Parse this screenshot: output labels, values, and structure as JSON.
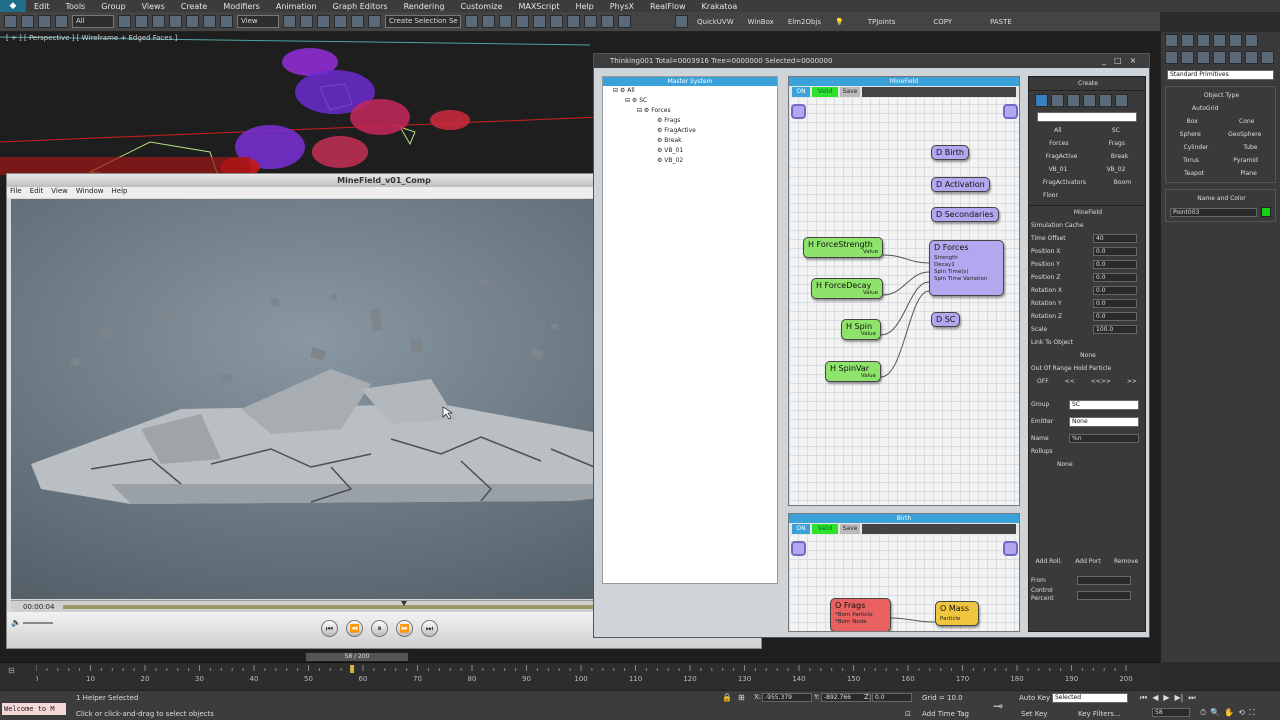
{
  "menu": [
    "Edit",
    "Tools",
    "Group",
    "Views",
    "Create",
    "Modifiers",
    "Animation",
    "Graph Editors",
    "Rendering",
    "Customize",
    "MAXScript",
    "Help",
    "PhysX",
    "RealFlow",
    "Krakatoa"
  ],
  "toolbar": {
    "filter": "All",
    "ref_coord": "View",
    "selection_set": "Create Selection Se",
    "quickuvw": "QuickUVW",
    "winbox": "WinBox",
    "elm2objs": "Elm2Objs",
    "tpjoints": "TPJoints",
    "copy": "COPY",
    "paste": "PASTE"
  },
  "viewport": {
    "label": "[ + ] [ Perspective ] [ Wireframe + Edged Faces ]"
  },
  "player": {
    "title": "MineField_v01_Comp",
    "menu": [
      "File",
      "Edit",
      "View",
      "Window",
      "Help"
    ],
    "time": "00:00:04",
    "buttons": [
      "⏮",
      "⏪",
      "⏸",
      "⏩",
      "⏭"
    ]
  },
  "thinking": {
    "title": "Thinking001  Total=0003916  Tree=0000000  Selected=0000000",
    "master_header": "Master System",
    "tree": [
      {
        "label": "All",
        "depth": 0
      },
      {
        "label": "SC",
        "depth": 1
      },
      {
        "label": "Forces",
        "depth": 2
      },
      {
        "label": "Frags",
        "depth": 3
      },
      {
        "label": "FragActive",
        "depth": 3
      },
      {
        "label": "Break",
        "depth": 3
      },
      {
        "label": "VB_01",
        "depth": 3
      },
      {
        "label": "VB_02",
        "depth": 3
      }
    ],
    "minefield_header": "MineField",
    "birth_header": "Birth",
    "bar": {
      "on": "ON",
      "valid": "Valid",
      "save": "Save"
    },
    "nodes": {
      "d_birth": "D Birth",
      "d_activation": "D Activation",
      "d_secondaries": "D Secondaries",
      "d_forces": "D Forces",
      "d_forces_list": [
        "Strength",
        "Decay1",
        "Spin Time(s)",
        "Spin Time Variation"
      ],
      "d_sc": "D SC",
      "h_forcestrength": "H ForceStrength",
      "h_forcedecay": "H ForceDecay",
      "h_spin": "H Spin",
      "h_spinvar": "H SpinVar",
      "value": "Value",
      "o_frags": "O Frags",
      "o_frags_list": [
        "*Born Particle",
        "*Born Node"
      ],
      "o_mass": "O Mass",
      "o_mass_sub": "Particle"
    },
    "create": {
      "header": "Create",
      "groups": [
        [
          "All",
          "SC"
        ],
        [
          "Forces",
          "Frags"
        ],
        [
          "FragActive",
          "Break"
        ],
        [
          "VB_01",
          "VB_02"
        ],
        [
          "FragActivators",
          "Boom"
        ],
        [
          "Floor",
          ""
        ]
      ],
      "minefield_header": "MineField",
      "sim_cache": "Simulation Cache",
      "fields": [
        {
          "label": "Time Offset",
          "value": "40"
        },
        {
          "label": "Position X",
          "value": "0.0"
        },
        {
          "label": "Position Y",
          "value": "0.0"
        },
        {
          "label": "Position Z",
          "value": "0.0"
        },
        {
          "label": "Rotation X",
          "value": "0.0"
        },
        {
          "label": "Rotation Y",
          "value": "0.0"
        },
        {
          "label": "Rotation Z",
          "value": "0.0"
        },
        {
          "label": "Scale",
          "value": "100.0"
        }
      ],
      "link_to_object": "Link To Object",
      "none": "None",
      "out_of_range": "Out Of Range Hold Particle",
      "nav": [
        "OFF",
        "<<",
        "<<>>",
        ">>"
      ],
      "group_label": "Group",
      "group_value": "SC",
      "emitter_label": "Emitter",
      "emitter_value": "None",
      "name_label": "Name",
      "name_value": "%n",
      "rollups_label": "Rollups",
      "rollups_value": "None",
      "actions": [
        "Add Roll.",
        "Add Port",
        "Remove"
      ],
      "from_label": "From",
      "control_label": "Control",
      "percent_label": "Percent"
    }
  },
  "rpanel": {
    "dropdown": "Standard Primitives",
    "object_type": "Object Type",
    "autogrid": "AutoGrid",
    "prims": [
      [
        "Box",
        "Cone"
      ],
      [
        "Sphere",
        "GeoSphere"
      ],
      [
        "Cylinder",
        "Tube"
      ],
      [
        "Torus",
        "Pyramid"
      ],
      [
        "Teapot",
        "Plane"
      ]
    ],
    "name_color": "Name and Color",
    "name_value": "Point003",
    "swatch": "#17d017"
  },
  "timeline": {
    "frame": "58 / 200",
    "ticks": [
      "0",
      "10",
      "20",
      "30",
      "40",
      "50",
      "60",
      "70",
      "80",
      "90",
      "100",
      "110",
      "120",
      "130",
      "140",
      "150",
      "160",
      "170",
      "180",
      "190",
      "200"
    ]
  },
  "status": {
    "listener": "Welcome to M",
    "selected": "1 Helper Selected",
    "prompt": "Click or click-and-drag to select objects",
    "x": "-955.379",
    "y": "-892.766",
    "z": "0.0",
    "grid": "Grid = 10.0",
    "add_time_tag": "Add Time Tag",
    "auto_key": "Auto Key",
    "set_key": "Set Key",
    "selected_dd": "Selected",
    "key_filters": "Key Filters...",
    "frame": "58"
  }
}
